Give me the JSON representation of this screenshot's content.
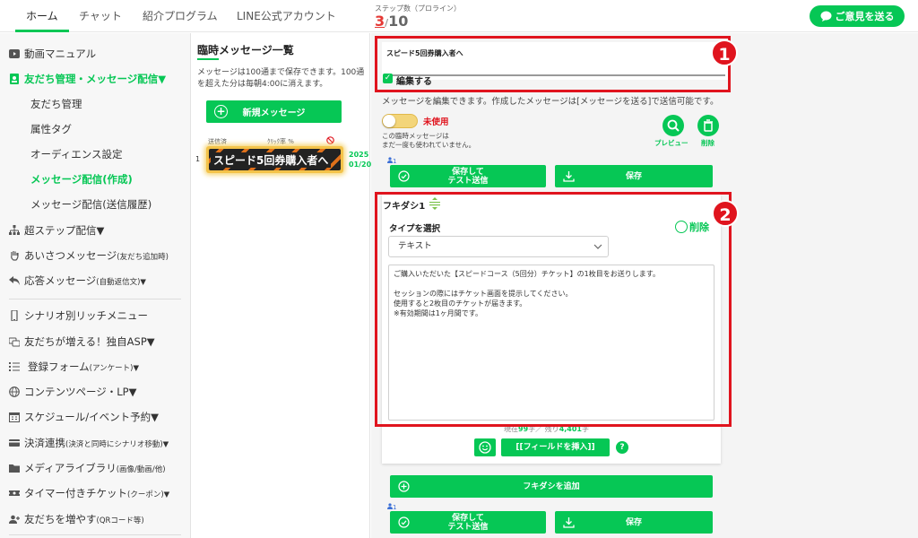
{
  "topbar": {
    "tabs": [
      {
        "label": "ホーム",
        "active": true
      },
      {
        "label": "チャット",
        "active": false
      },
      {
        "label": "紹介プログラム",
        "active": false
      },
      {
        "label": "LINE公式アカウント",
        "active": false
      }
    ],
    "step_label": "ステップ数（プロライン）",
    "step_current": "3",
    "step_sep": "/",
    "step_total": "10",
    "feedback_label": "ご意見を送る"
  },
  "sidebar": {
    "items": [
      {
        "label": "動画マニュアル",
        "icon": "video-icon"
      },
      {
        "label": "友だち管理・メッセージ配信▼",
        "icon": "contacts-icon",
        "highlight": true
      },
      {
        "label": "友だち管理",
        "sub": true
      },
      {
        "label": "属性タグ",
        "sub": true
      },
      {
        "label": "オーディエンス設定",
        "sub": true
      },
      {
        "label": "メッセージ配信(作成)",
        "sub": true,
        "highlight": true
      },
      {
        "label": "メッセージ配信(送信履歴)",
        "sub": true
      },
      {
        "label": "超ステップ配信▼",
        "icon": "sitemap-icon"
      },
      {
        "label": "あいさつメッセージ",
        "small": "(友だち追加時)",
        "icon": "hand-icon"
      },
      {
        "label": "応答メッセージ",
        "small": "(自動返信文)▼",
        "icon": "reply-icon"
      },
      {
        "label": "シナリオ別リッチメニュー",
        "icon": "phone-icon"
      },
      {
        "label": "友だちが増える！独自ASP▼",
        "icon": "asp-icon"
      },
      {
        "label": "登録フォーム",
        "small": "(アンケート)▼",
        "icon": "list-icon"
      },
      {
        "label": "コンテンツページ・LP▼",
        "icon": "globe-icon"
      },
      {
        "label": "スケジュール/イベント予約▼",
        "icon": "calendar-icon"
      },
      {
        "label": "決済連携",
        "small": "(決済と同時にシナリオ移動)▼",
        "icon": "card-icon"
      },
      {
        "label": "メディアライブラリ",
        "small": "(画像/動画/他)",
        "icon": "folder-icon"
      },
      {
        "label": "タイマー付きチケット",
        "small": "(クーポン)▼",
        "icon": "ticket-icon"
      },
      {
        "label": "友だちを増やす",
        "small": "(QRコード等)",
        "icon": "user-plus-icon"
      }
    ]
  },
  "mid": {
    "title": "臨時メッセージ一覧",
    "note": "メッセージは100通まで保存できます。100通を超えた分は毎朝4:00に消えます。",
    "new_button": "新規メッセージ",
    "col_sent": "送信済",
    "col_click": "ｸﾘｯｸ率 %",
    "row": {
      "num": "1",
      "title": "スピード5回券購入者へ",
      "date_year": "2025",
      "date_md": "01/20"
    }
  },
  "right": {
    "badge1": "1",
    "badge2": "2",
    "message_title": "スピード5回券購入者へ",
    "edit_label": "編集する",
    "edit_desc": "メッセージを編集できます。作成したメッセージは[メッセージを送る]で送信可能です。",
    "toggle_label": "未使用",
    "unused_note_1": "この臨時メッセージは",
    "unused_note_2": "まだ一度も使われていません。",
    "preview_label": "プレビュー",
    "delete_label": "削除",
    "user_count": "1",
    "save_test_line1": "保存して",
    "save_test_line2": "テスト送信",
    "save_label": "保存",
    "fukidashi_title": "フキダシ1",
    "type_label": "タイプを選択",
    "fuki_delete": "削除",
    "type_value": "テキスト",
    "message_body": "ご購入いただいた【スピードコース（5回分）チケット】の1枚目をお送りします。\n\nセッションの際にはチケット画面を提示してください。\n使用すると2枚目のチケットが届きます。\n※有効期間は1ヶ月間です。",
    "count_prefix": "現在",
    "count_current": "99",
    "count_mid": "字／ 残り",
    "count_remaining": "4,401",
    "count_suffix": "字",
    "insert_field": "[[フィールドを挿入]]",
    "help": "?",
    "add_fukidashi": "フキダシを追加",
    "user_count_2": "1"
  },
  "colors": {
    "accent": "#06c755",
    "highlight_red": "#e0141e",
    "toggle_off": "#f3d57a"
  }
}
